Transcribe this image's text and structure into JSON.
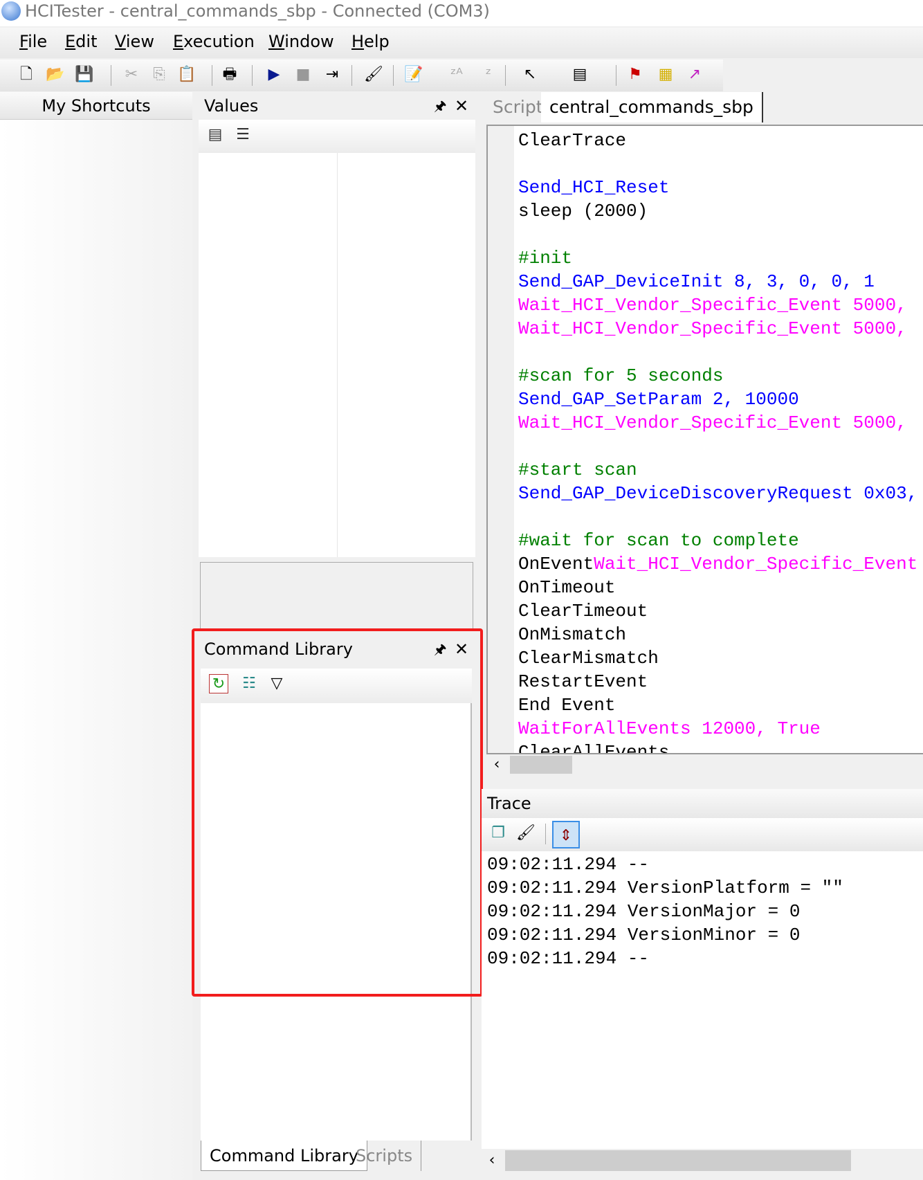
{
  "window": {
    "title": "HCITester - central_commands_sbp - Connected (COM3)"
  },
  "menu": [
    {
      "label": "File",
      "mn": "F",
      "rest": "ile"
    },
    {
      "label": "Edit",
      "mn": "E",
      "rest": "dit"
    },
    {
      "label": "View",
      "mn": "V",
      "rest": "iew"
    },
    {
      "label": "Execution",
      "mn": "E",
      "rest": "xecution"
    },
    {
      "label": "Window",
      "mn": "W",
      "rest": "indow"
    },
    {
      "label": "Help",
      "mn": "H",
      "rest": "elp"
    }
  ],
  "toolbar_icons": [
    "new-file-icon",
    "open-folder-icon",
    "save-icon",
    "cut-icon",
    "copy-icon",
    "paste-icon",
    "print-icon",
    "run-icon",
    "stop-icon",
    "step-icon",
    "clear-icon",
    "properties-icon",
    "sort-az-icon",
    "sort-za-icon",
    "pointer-icon",
    "window-list-icon",
    "connect-icon",
    "hci-icon",
    "link-icon"
  ],
  "shortcuts": {
    "title": "My Shortcuts"
  },
  "values": {
    "title": "Values"
  },
  "command_library": {
    "title": "Command Library"
  },
  "bottom_tabs": [
    {
      "label": "Command Library",
      "active": true
    },
    {
      "label": "Scripts",
      "active": false
    }
  ],
  "editor": {
    "tabs": [
      {
        "label": "Script",
        "active": false
      },
      {
        "label": "central_commands_sbp",
        "active": true
      }
    ],
    "lines": [
      [
        {
          "t": "ClearTrace",
          "c": "black"
        }
      ],
      [],
      [
        {
          "t": "Send_HCI_Reset",
          "c": "blue"
        }
      ],
      [
        {
          "t": "sleep (2000)",
          "c": "black"
        }
      ],
      [],
      [
        {
          "t": "#init",
          "c": "green"
        }
      ],
      [
        {
          "t": "Send_GAP_DeviceInit 8, 3, 0, 0, 1",
          "c": "blue"
        }
      ],
      [
        {
          "t": "Wait_HCI_Vendor_Specific_Event 5000,",
          "c": "magenta"
        }
      ],
      [
        {
          "t": "Wait_HCI_Vendor_Specific_Event 5000,",
          "c": "magenta"
        }
      ],
      [],
      [
        {
          "t": "#scan for 5 seconds",
          "c": "green"
        }
      ],
      [
        {
          "t": "Send_GAP_SetParam 2, 10000",
          "c": "blue"
        }
      ],
      [
        {
          "t": "Wait_HCI_Vendor_Specific_Event 5000,",
          "c": "magenta"
        }
      ],
      [],
      [
        {
          "t": "#start scan",
          "c": "green"
        }
      ],
      [
        {
          "t": "Send_GAP_DeviceDiscoveryRequest 0x03,",
          "c": "blue"
        }
      ],
      [],
      [
        {
          "t": "#wait for scan to complete",
          "c": "green"
        }
      ],
      [
        {
          "t": "OnEvent",
          "c": "black"
        },
        {
          "t": "Wait_HCI_Vendor_Specific_Event",
          "c": "magenta"
        }
      ],
      [
        {
          "t": "OnTimeout",
          "c": "black"
        }
      ],
      [
        {
          "t": "ClearTimeout",
          "c": "black"
        }
      ],
      [
        {
          "t": "OnMismatch",
          "c": "black"
        }
      ],
      [
        {
          "t": "ClearMismatch",
          "c": "black"
        }
      ],
      [
        {
          "t": "RestartEvent",
          "c": "black"
        }
      ],
      [
        {
          "t": "End Event",
          "c": "black"
        }
      ],
      [
        {
          "t": "WaitForAllEvents 12000, True",
          "c": "magenta"
        }
      ],
      [
        {
          "t": "ClearAllEvents",
          "c": "black"
        }
      ]
    ]
  },
  "trace": {
    "title": "Trace",
    "lines": [
      "09:02:11.294 --",
      "09:02:11.294 VersionPlatform = \"\"",
      "09:02:11.294 VersionMajor = 0",
      "09:02:11.294 VersionMinor = 0",
      "09:02:11.294 --"
    ]
  },
  "colors": {
    "keyword_blue": "#0000ff",
    "comment_green": "#008000",
    "event_magenta": "#ff00ff",
    "highlight_red": "#f21d1d"
  }
}
